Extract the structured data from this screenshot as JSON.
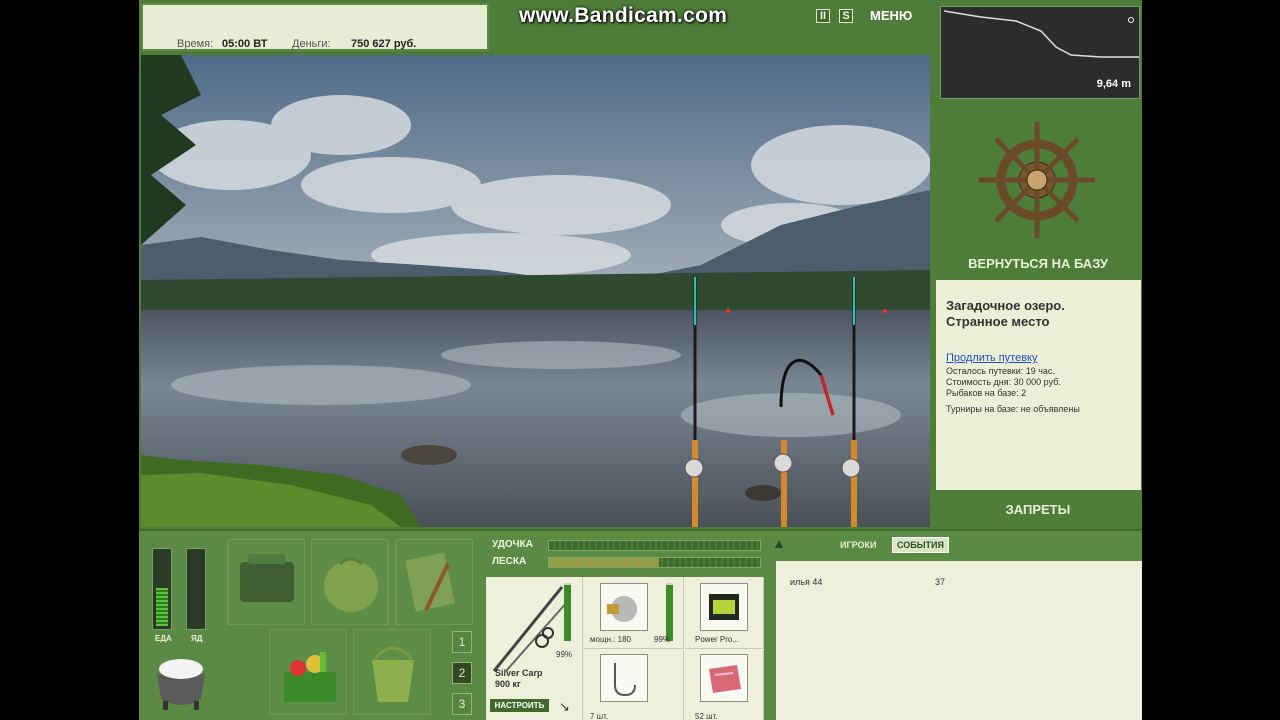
{
  "watermark": "www.Bandicam.com",
  "info": {
    "time_label": "Время:",
    "time_value": "05:00 ВТ",
    "money_label": "Деньги:",
    "money_value": "750 627 руб."
  },
  "toolbar": {
    "pause_label": "II",
    "sound_label": "S",
    "menu_label": "МЕНЮ"
  },
  "depth": {
    "value": "9,64 m"
  },
  "right_panel": {
    "return_label": "ВЕРНУТЬСЯ НА БАЗУ",
    "lake_title_line1": "Загадочное озеро.",
    "lake_title_line2": "Странное место",
    "extend_link": "Продлить путевку",
    "remaining": "Осталось путевки: 19 час.",
    "day_cost": "Стоимость дня: 30 000 руб.",
    "fishers": "Рыбаков на базе: 2",
    "tournaments": "Турниры на базе: не объявлены",
    "bans_label": "ЗАПРЕТЫ"
  },
  "status": {
    "food_label": "ЕДА",
    "poison_label": "ЯД",
    "food_level": 0.55,
    "poison_level": 0.0
  },
  "pages": [
    "1",
    "2",
    "3"
  ],
  "active_page": 1,
  "gear": {
    "rod_label": "УДОЧКА",
    "line_label": "ЛЕСКА",
    "rod_tension": 0.0,
    "line_tension": 0.52,
    "rod_name": "Silver Carp",
    "rod_capacity": "900 кг",
    "rod_condition": "99%",
    "reel_power": "мощн.: 180",
    "reel_condition": "99%",
    "line_name": "Power Pro...",
    "hooks_count": "7 шт.",
    "bait_count": "52 шт.",
    "adjust_label": "НАСТРОИТЬ",
    "rod_level": 0.97,
    "reel_level": 0.97
  },
  "social": {
    "tab_players": "ИГРОКИ",
    "tab_events": "СОБЫТИЯ",
    "players": [
      {
        "name": "илья 44",
        "value": "37"
      }
    ]
  },
  "colors": {
    "panel_green": "#4e7d3a",
    "panel_light": "#eceed6",
    "link_blue": "#1d4ec7"
  }
}
